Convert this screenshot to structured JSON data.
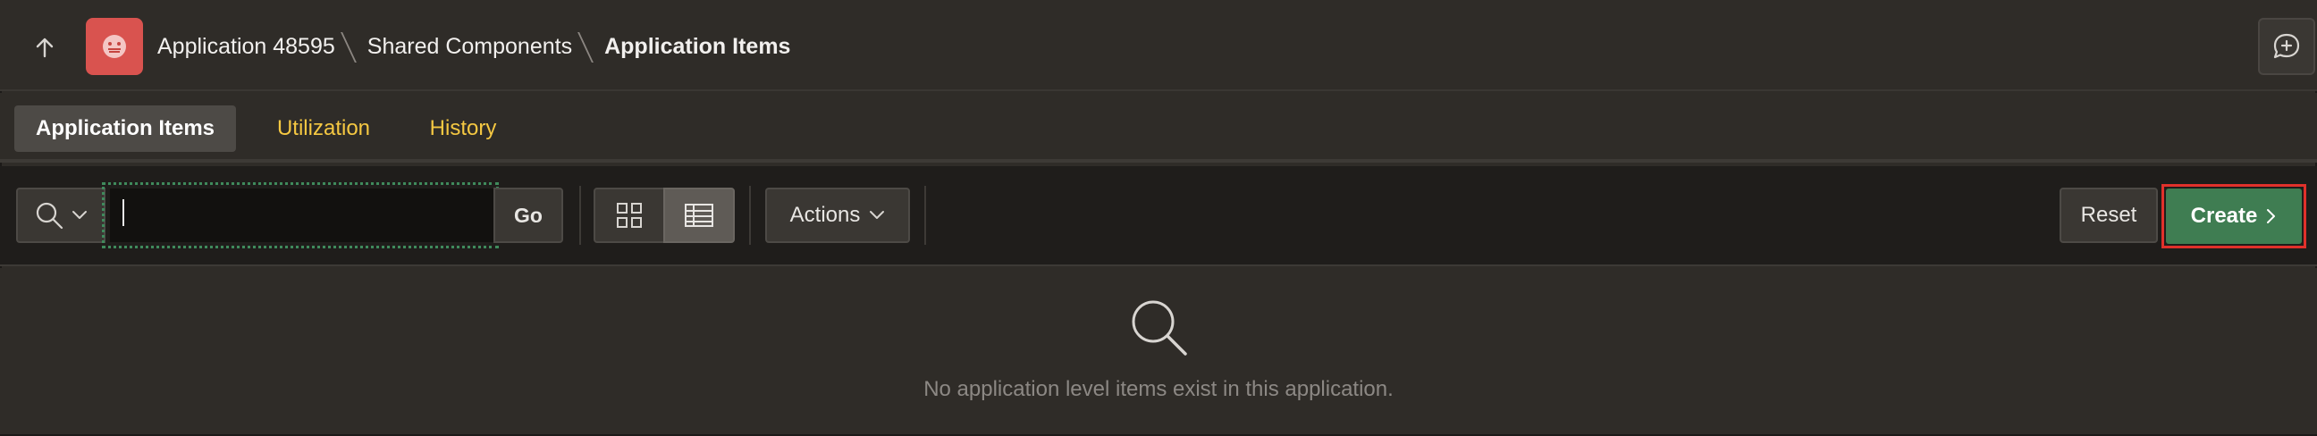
{
  "header": {
    "up_icon": "arrow-up-icon",
    "app_icon": "app-face-icon",
    "app_icon_color": "#d9534f",
    "breadcrumbs": [
      "Application 48595",
      "Shared Components"
    ],
    "current_page": "Application Items",
    "feedback_icon": "chat-plus-icon"
  },
  "tabs": [
    {
      "label": "Application Items",
      "active": true
    },
    {
      "label": "Utilization",
      "active": false
    },
    {
      "label": "History",
      "active": false
    }
  ],
  "toolbar": {
    "search_icon": "search-icon",
    "search_value": "",
    "go_label": "Go",
    "view_icons": [
      "icon-view-icon",
      "report-view-icon"
    ],
    "active_view": "report",
    "actions_label": "Actions",
    "reset_label": "Reset",
    "create_label": "Create"
  },
  "empty_state": {
    "icon": "search-icon",
    "message": "No application level items exist in this application."
  },
  "colors": {
    "accent_tab": "#f5c842",
    "create_button": "#3f7d52",
    "highlight_border": "#e0312b"
  }
}
